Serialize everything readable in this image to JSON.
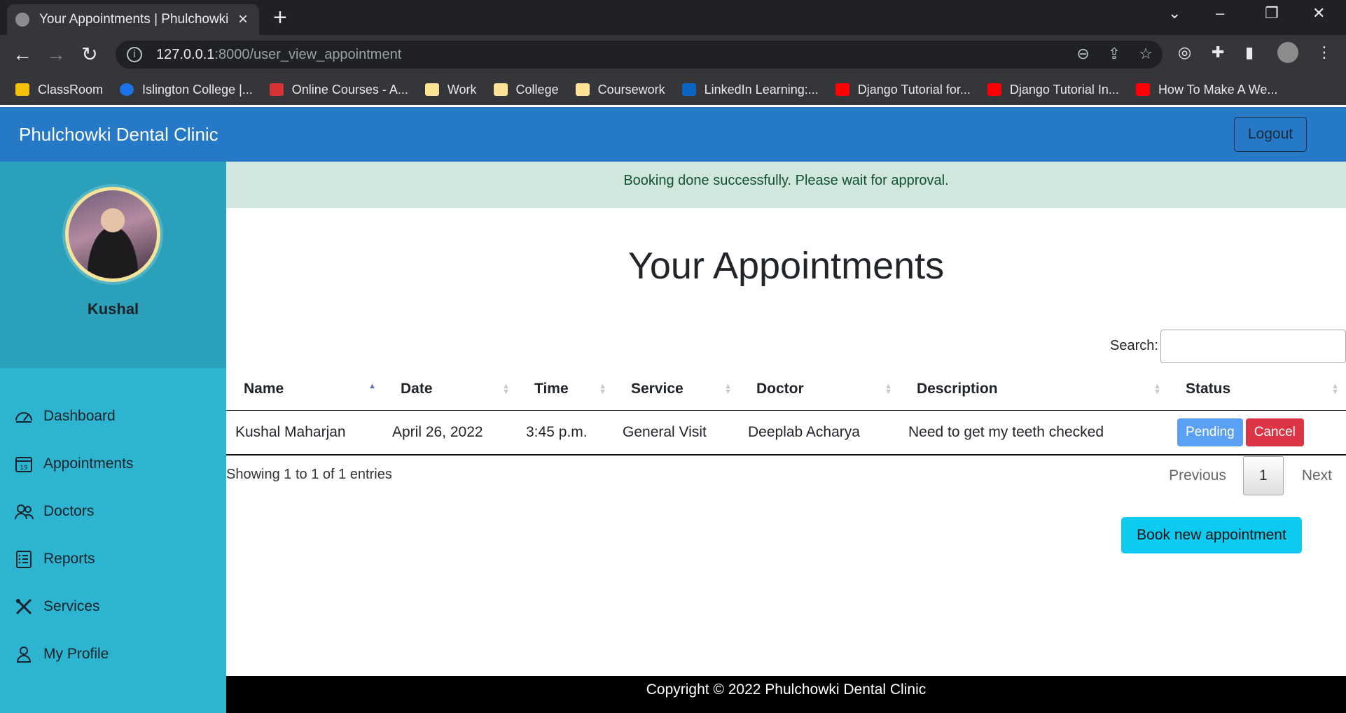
{
  "browser": {
    "tab_title": "Your Appointments | Phulchowki",
    "url_host": "127.0.0.1",
    "url_path": ":8000/user_view_appointment",
    "bookmarks": [
      "ClassRoom",
      "Islington College |...",
      "Online Courses - A...",
      "Work",
      "College",
      "Coursework",
      "LinkedIn Learning:...",
      "Django Tutorial for...",
      "Django Tutorial In...",
      "How To Make A We..."
    ]
  },
  "navbar": {
    "brand": "Phulchowki Dental Clinic",
    "logout": "Logout"
  },
  "sidebar": {
    "username": "Kushal",
    "items": [
      {
        "label": "Dashboard",
        "icon": "speedometer-icon"
      },
      {
        "label": "Appointments",
        "icon": "calendar-icon"
      },
      {
        "label": "Doctors",
        "icon": "people-icon"
      },
      {
        "label": "Reports",
        "icon": "list-icon"
      },
      {
        "label": "Services",
        "icon": "tools-icon"
      },
      {
        "label": "My Profile",
        "icon": "person-icon"
      }
    ],
    "calendar_day": "19"
  },
  "main": {
    "alert": "Booking done successfully. Please wait for approval.",
    "heading": "Your Appointments",
    "search_label": "Search:",
    "table": {
      "headers": [
        "Name",
        "Date",
        "Time",
        "Service",
        "Doctor",
        "Description",
        "Status"
      ],
      "rows": [
        {
          "name": "Kushal Maharjan",
          "date": "April 26, 2022",
          "time": "3:45 p.m.",
          "service": "General Visit",
          "doctor": "Deeplab Acharya",
          "description": "Need to get my teeth checked",
          "status": "Pending",
          "cancel": "Cancel"
        }
      ]
    },
    "info": "Showing 1 to 1 of 1 entries",
    "pager": {
      "previous": "Previous",
      "page": "1",
      "next": "Next"
    },
    "book_button": "Book new appointment"
  },
  "footer": "Copyright © 2022 Phulchowki Dental Clinic",
  "colors": {
    "navbar": "#2579c7",
    "sidebar": "#2db4d1",
    "alert_bg": "#d1e7dd",
    "pending": "#5aa1f5",
    "cancel": "#dc3545",
    "book": "#0dcaf0"
  }
}
